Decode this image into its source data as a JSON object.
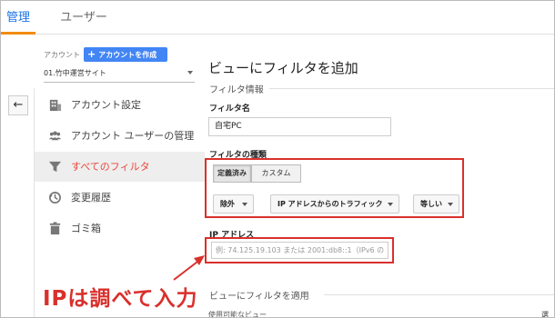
{
  "tabs": [
    {
      "label": "管理"
    },
    {
      "label": "ユーザー"
    }
  ],
  "account": {
    "label": "アカウント",
    "create_button": "アカウントを作成",
    "selected_account": "01.竹中運営サイト"
  },
  "menu": [
    {
      "label": "アカウント設定",
      "icon": "building-icon"
    },
    {
      "label": "アカウント ユーザーの管理",
      "icon": "users-icon"
    },
    {
      "label": "すべてのフィルタ",
      "icon": "filter-icon",
      "active": true
    },
    {
      "label": "変更履歴",
      "icon": "history-icon"
    },
    {
      "label": "ゴミ箱",
      "icon": "trash-icon"
    }
  ],
  "main": {
    "title": "ビューにフィルタを追加",
    "filter_info_heading": "フィルタ情報",
    "filter_name_label": "フィルタ名",
    "filter_name_value": "自宅PC",
    "filter_type_label": "フィルタの種類",
    "type_tabs": [
      "定義済み",
      "カスタム"
    ],
    "dropdowns": [
      "除外",
      "IP アドレスからのトラフィック",
      "等しい"
    ],
    "ip_label": "IP アドレス",
    "ip_placeholder": "例: 74.125.19.103 または 2001:db8::1（IPv6 の",
    "apply_heading": "ビューにフィルタを適用",
    "available_views": "使用可能なビュー",
    "selected_cut": "選"
  },
  "annotation": {
    "text": "IPは調べて入力"
  },
  "colors": {
    "accent_blue": "#4285f4",
    "tab_underline": "#f28b10",
    "active_red": "#e9473a",
    "annotation_red": "#d9302c"
  }
}
